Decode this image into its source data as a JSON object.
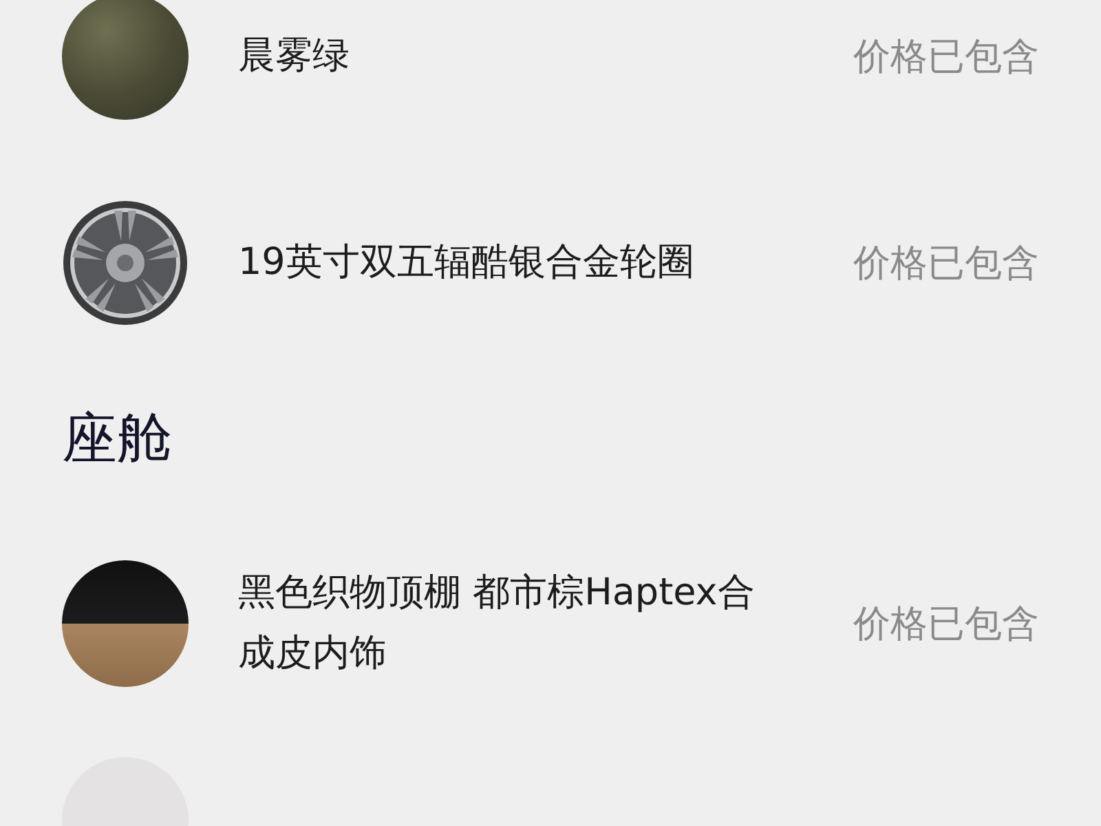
{
  "sections": [
    {
      "items": [
        {
          "kind": "paint",
          "name": "晨雾绿",
          "price": "价格已包含"
        },
        {
          "kind": "wheel",
          "name": "19英寸双五辐酷银合金轮圈",
          "price": "价格已包含"
        }
      ]
    },
    {
      "title": "座舱",
      "items": [
        {
          "kind": "interior",
          "name": "黑色织物顶棚 都市棕Haptex合成皮内饰",
          "price": "价格已包含"
        },
        {
          "kind": "pale"
        }
      ]
    }
  ]
}
